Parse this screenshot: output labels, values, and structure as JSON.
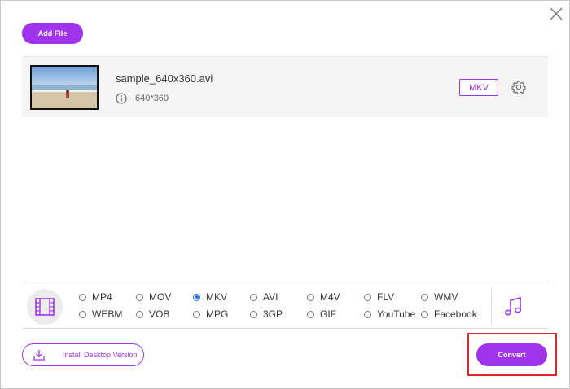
{
  "toolbar": {
    "add_file_label": "Add File"
  },
  "file": {
    "name": "sample_640x360.avi",
    "resolution": "640*360",
    "output_format": "MKV"
  },
  "formats": {
    "selected": "MKV",
    "row1": [
      "MP4",
      "MOV",
      "MKV",
      "AVI",
      "M4V",
      "FLV",
      "WMV"
    ],
    "row2": [
      "WEBM",
      "VOB",
      "MPG",
      "3GP",
      "GIF",
      "YouTube",
      "Facebook"
    ]
  },
  "footer": {
    "install_label": "Install Desktop Version",
    "convert_label": "Convert"
  },
  "colors": {
    "accent": "#a033ec",
    "radio_selected": "#1a73e8",
    "highlight_box": "#e0252a"
  },
  "icons": {
    "close": "close-icon",
    "info": "info-icon",
    "settings": "gear-icon",
    "video_category": "film-icon",
    "audio_category": "music-note-icon",
    "download": "download-icon"
  }
}
